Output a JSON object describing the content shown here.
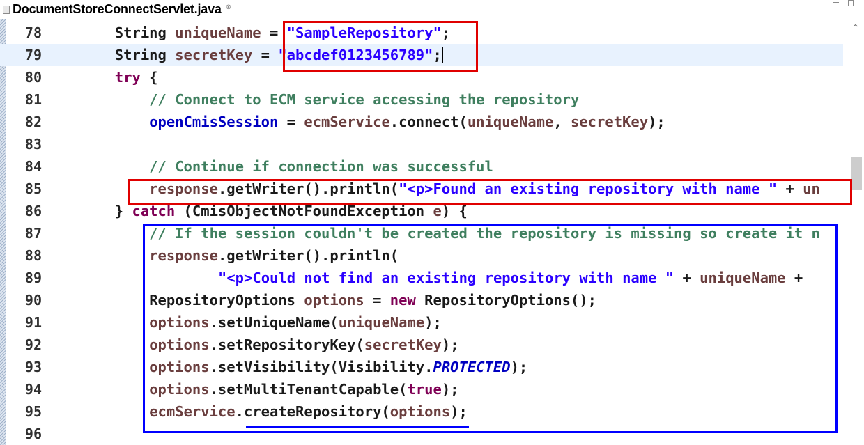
{
  "tab": {
    "title": "DocumentStoreConnectServlet.java",
    "close_symbol": "⊗"
  },
  "editor": {
    "lines": [
      {
        "num": "78",
        "indent": 8,
        "tokens": [
          {
            "t": "plain",
            "v": "String "
          },
          {
            "t": "var",
            "v": "uniqueName"
          },
          {
            "t": "plain",
            "v": " = "
          },
          {
            "t": "str",
            "v": "\"SampleRepository\""
          },
          {
            "t": "plain",
            "v": ";"
          }
        ]
      },
      {
        "num": "79",
        "indent": 8,
        "current": true,
        "tokens": [
          {
            "t": "plain",
            "v": "String "
          },
          {
            "t": "var",
            "v": "secretKey"
          },
          {
            "t": "plain",
            "v": " = "
          },
          {
            "t": "str",
            "v": "\"abcdef0123456789\""
          },
          {
            "t": "plain",
            "v": ";"
          }
        ]
      },
      {
        "num": "80",
        "indent": 8,
        "tokens": [
          {
            "t": "kw",
            "v": "try"
          },
          {
            "t": "plain",
            "v": " {"
          }
        ]
      },
      {
        "num": "81",
        "indent": 12,
        "tokens": [
          {
            "t": "cm",
            "v": "// Connect to ECM service accessing the repository"
          }
        ]
      },
      {
        "num": "82",
        "indent": 12,
        "tokens": [
          {
            "t": "fld",
            "v": "openCmisSession"
          },
          {
            "t": "plain",
            "v": " = "
          },
          {
            "t": "var",
            "v": "ecmService"
          },
          {
            "t": "plain",
            "v": ".connect("
          },
          {
            "t": "var",
            "v": "uniqueName"
          },
          {
            "t": "plain",
            "v": ", "
          },
          {
            "t": "var",
            "v": "secretKey"
          },
          {
            "t": "plain",
            "v": ");"
          }
        ]
      },
      {
        "num": "83",
        "indent": 12,
        "tokens": []
      },
      {
        "num": "84",
        "indent": 12,
        "tokens": [
          {
            "t": "cm",
            "v": "// Continue if connection was successful"
          }
        ]
      },
      {
        "num": "85",
        "indent": 12,
        "tokens": [
          {
            "t": "var",
            "v": "response"
          },
          {
            "t": "plain",
            "v": ".getWriter().println("
          },
          {
            "t": "str",
            "v": "\"<p>Found an existing repository with name \""
          },
          {
            "t": "plain",
            "v": " + "
          },
          {
            "t": "var",
            "v": "un"
          }
        ]
      },
      {
        "num": "86",
        "indent": 8,
        "tokens": [
          {
            "t": "plain",
            "v": "} "
          },
          {
            "t": "kw",
            "v": "catch"
          },
          {
            "t": "plain",
            "v": " (CmisObjectNotFoundException "
          },
          {
            "t": "var",
            "v": "e"
          },
          {
            "t": "plain",
            "v": ") {"
          }
        ]
      },
      {
        "num": "87",
        "indent": 12,
        "tokens": [
          {
            "t": "cm",
            "v": "// If the session couldn't be created the repository is missing so create it n"
          }
        ]
      },
      {
        "num": "88",
        "indent": 12,
        "tokens": [
          {
            "t": "var",
            "v": "response"
          },
          {
            "t": "plain",
            "v": ".getWriter().println("
          }
        ]
      },
      {
        "num": "89",
        "indent": 20,
        "tokens": [
          {
            "t": "str",
            "v": "\"<p>Could not find an existing repository with name \""
          },
          {
            "t": "plain",
            "v": " + "
          },
          {
            "t": "var",
            "v": "uniqueName"
          },
          {
            "t": "plain",
            "v": " +"
          }
        ]
      },
      {
        "num": "90",
        "indent": 12,
        "tokens": [
          {
            "t": "plain",
            "v": "RepositoryOptions "
          },
          {
            "t": "var",
            "v": "options"
          },
          {
            "t": "plain",
            "v": " = "
          },
          {
            "t": "kw",
            "v": "new"
          },
          {
            "t": "plain",
            "v": " RepositoryOptions();"
          }
        ]
      },
      {
        "num": "91",
        "indent": 12,
        "tokens": [
          {
            "t": "var",
            "v": "options"
          },
          {
            "t": "plain",
            "v": ".setUniqueName("
          },
          {
            "t": "var",
            "v": "uniqueName"
          },
          {
            "t": "plain",
            "v": ");"
          }
        ]
      },
      {
        "num": "92",
        "indent": 12,
        "tokens": [
          {
            "t": "var",
            "v": "options"
          },
          {
            "t": "plain",
            "v": ".setRepositoryKey("
          },
          {
            "t": "var",
            "v": "secretKey"
          },
          {
            "t": "plain",
            "v": ");"
          }
        ]
      },
      {
        "num": "93",
        "indent": 12,
        "tokens": [
          {
            "t": "var",
            "v": "options"
          },
          {
            "t": "plain",
            "v": ".setVisibility(Visibility."
          },
          {
            "t": "italic-const",
            "v": "PROTECTED"
          },
          {
            "t": "plain",
            "v": ");"
          }
        ]
      },
      {
        "num": "94",
        "indent": 12,
        "tokens": [
          {
            "t": "var",
            "v": "options"
          },
          {
            "t": "plain",
            "v": ".setMultiTenantCapable("
          },
          {
            "t": "kw",
            "v": "true"
          },
          {
            "t": "plain",
            "v": ");"
          }
        ]
      },
      {
        "num": "95",
        "indent": 12,
        "tokens": [
          {
            "t": "var",
            "v": "ecmService"
          },
          {
            "t": "plain",
            "v": ".createRepository("
          },
          {
            "t": "var",
            "v": "options"
          },
          {
            "t": "plain",
            "v": ");"
          }
        ]
      },
      {
        "num": "96",
        "indent": 12,
        "tokens": []
      }
    ]
  },
  "colors": {
    "keyword": "#7f0055",
    "string": "#2a00ff",
    "comment": "#3f7f5f",
    "field": "#0000c0",
    "local_variable": "#6a3e3e",
    "current_line": "#e8f2fe",
    "highlight_red": "#e00000",
    "highlight_blue": "#0000ff"
  }
}
